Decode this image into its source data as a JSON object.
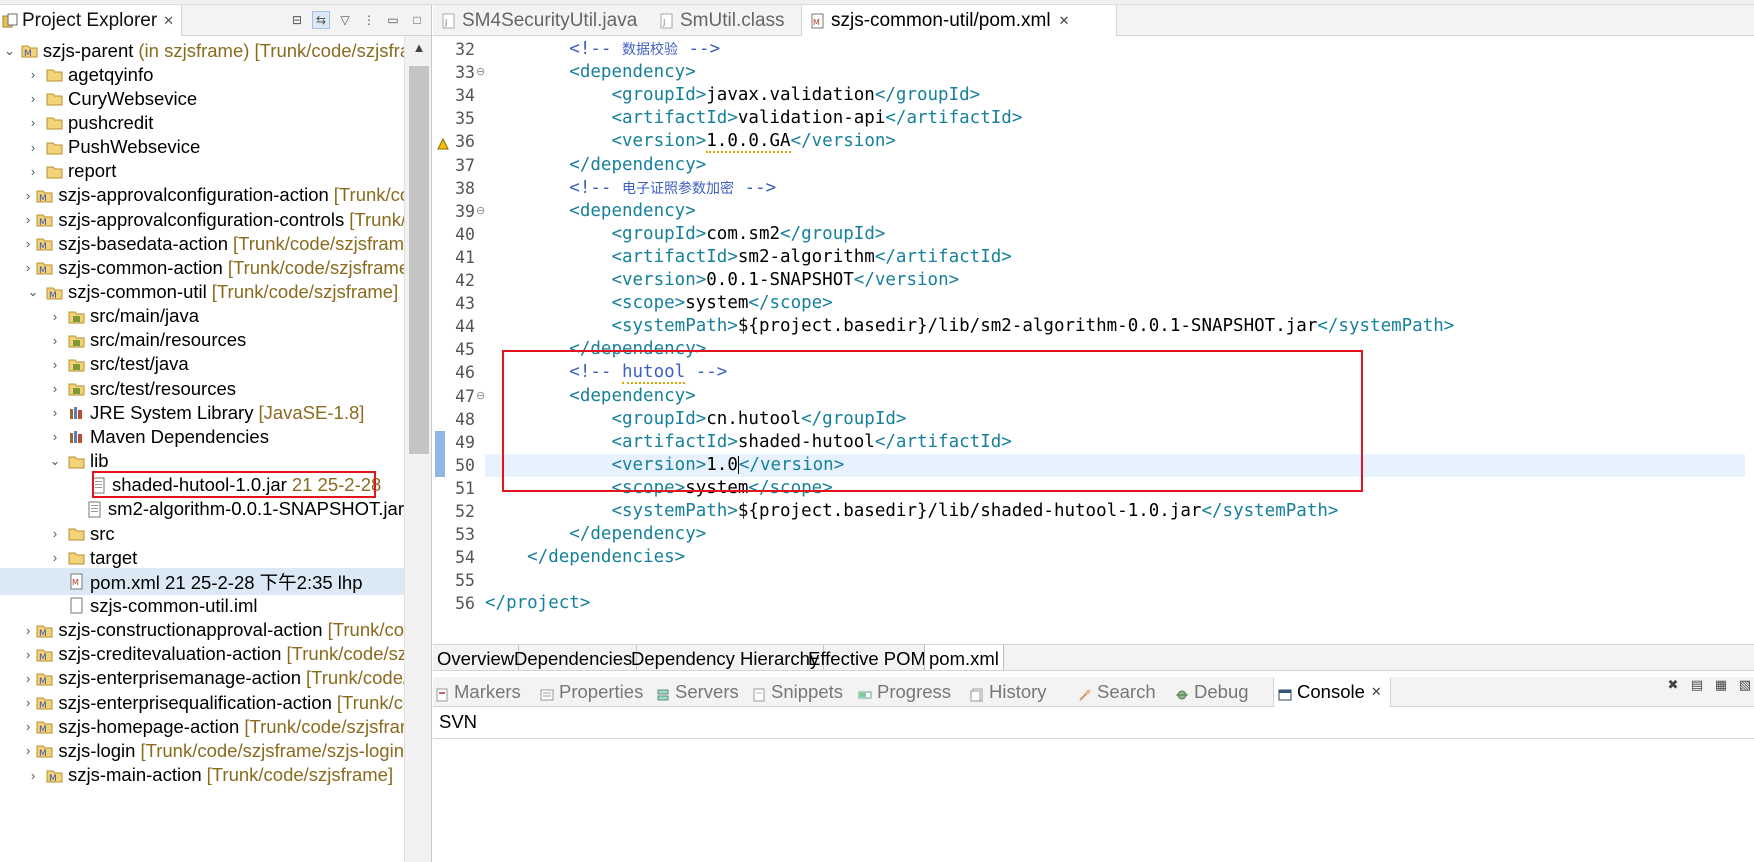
{
  "explorer": {
    "title": "Project Explorer",
    "tree": [
      {
        "label": "szjs-parent",
        "decor": " (in szjsframe) [Trunk/code/szjsframe]",
        "icon": "maven-project-icon",
        "twisty": "open",
        "depth": 0
      },
      {
        "label": "agetqyinfo",
        "decor": "",
        "icon": "folder-icon",
        "twisty": "closed",
        "depth": 1
      },
      {
        "label": "CuryWebsevice",
        "decor": "",
        "icon": "folder-icon",
        "twisty": "closed",
        "depth": 1
      },
      {
        "label": "pushcredit",
        "decor": "",
        "icon": "folder-icon",
        "twisty": "closed",
        "depth": 1
      },
      {
        "label": "PushWebsevice",
        "decor": "",
        "icon": "folder-icon",
        "twisty": "closed",
        "depth": 1
      },
      {
        "label": "report",
        "decor": "",
        "icon": "folder-icon",
        "twisty": "closed",
        "depth": 1
      },
      {
        "label": "szjs-approvalconfiguration-action",
        "decor": " [Trunk/code/szjsframe]",
        "icon": "maven-project-icon",
        "twisty": "closed",
        "depth": 1
      },
      {
        "label": "szjs-approvalconfiguration-controls",
        "decor": " [Trunk/code/szjsframe]",
        "icon": "maven-project-icon",
        "twisty": "closed",
        "depth": 1
      },
      {
        "label": "szjs-basedata-action",
        "decor": " [Trunk/code/szjsframe]",
        "icon": "maven-project-icon",
        "twisty": "closed",
        "depth": 1
      },
      {
        "label": "szjs-common-action",
        "decor": " [Trunk/code/szjsframe]",
        "icon": "maven-project-icon",
        "twisty": "closed",
        "depth": 1
      },
      {
        "label": "szjs-common-util",
        "decor": " [Trunk/code/szjsframe]",
        "icon": "maven-project-icon",
        "twisty": "open",
        "depth": 1
      },
      {
        "label": "src/main/java",
        "decor": "",
        "icon": "source-folder-icon",
        "twisty": "closed",
        "depth": 2
      },
      {
        "label": "src/main/resources",
        "decor": "",
        "icon": "source-folder-icon",
        "twisty": "closed",
        "depth": 2
      },
      {
        "label": "src/test/java",
        "decor": "",
        "icon": "source-folder-icon",
        "twisty": "closed",
        "depth": 2
      },
      {
        "label": "src/test/resources",
        "decor": "",
        "icon": "source-folder-icon",
        "twisty": "closed",
        "depth": 2
      },
      {
        "label": "JRE System Library",
        "decor": " [JavaSE-1.8]",
        "icon": "library-icon",
        "twisty": "closed",
        "depth": 2
      },
      {
        "label": "Maven Dependencies",
        "decor": "",
        "icon": "library-icon",
        "twisty": "closed",
        "depth": 2
      },
      {
        "label": "lib",
        "decor": "",
        "icon": "folder-icon",
        "twisty": "open",
        "depth": 2
      },
      {
        "label": "shaded-hutool-1.0.jar",
        "decor": " 21  25-2-28",
        "icon": "jar-file-icon",
        "twisty": "none",
        "depth": 3
      },
      {
        "label": "sm2-algorithm-0.0.1-SNAPSHOT.jar",
        "decor": "",
        "icon": "jar-file-icon",
        "twisty": "none",
        "depth": 3
      },
      {
        "label": "src",
        "decor": "",
        "icon": "folder-icon",
        "twisty": "closed",
        "depth": 2
      },
      {
        "label": "target",
        "decor": "",
        "icon": "folder-icon",
        "twisty": "closed",
        "depth": 2
      },
      {
        "label": "pom.xml 21  25-2-28 下午2:35  lhp",
        "decor": "",
        "icon": "xml-file-icon",
        "twisty": "none",
        "depth": 2,
        "selected": true
      },
      {
        "label": "szjs-common-util.iml",
        "decor": "",
        "icon": "file-icon",
        "twisty": "none",
        "depth": 2
      },
      {
        "label": "szjs-constructionapproval-action",
        "decor": " [Trunk/code/szjsframe]",
        "icon": "maven-project-icon",
        "twisty": "closed",
        "depth": 1
      },
      {
        "label": "szjs-creditevaluation-action",
        "decor": " [Trunk/code/szjsframe]",
        "icon": "maven-project-icon",
        "twisty": "closed",
        "depth": 1
      },
      {
        "label": "szjs-enterprisemanage-action",
        "decor": " [Trunk/code/szjsframe]",
        "icon": "maven-project-icon",
        "twisty": "closed",
        "depth": 1
      },
      {
        "label": "szjs-enterprisequalification-action",
        "decor": " [Trunk/code/szjsframe]",
        "icon": "maven-project-icon",
        "twisty": "closed",
        "depth": 1
      },
      {
        "label": "szjs-homepage-action",
        "decor": " [Trunk/code/szjsframe]",
        "icon": "maven-project-icon",
        "twisty": "closed",
        "depth": 1
      },
      {
        "label": "szjs-login",
        "decor": " [Trunk/code/szjsframe/szjs-login]",
        "icon": "maven-project-icon",
        "twisty": "closed",
        "depth": 1
      },
      {
        "label": "szjs-main-action",
        "decor": " [Trunk/code/szjsframe]",
        "icon": "maven-project-icon",
        "twisty": "closed",
        "depth": 1
      }
    ]
  },
  "editor": {
    "tabs": [
      {
        "label": "SM4SecurityUtil.java",
        "active": false
      },
      {
        "label": "SmUtil.class",
        "active": false
      },
      {
        "label": "szjs-common-util/pom.xml",
        "active": true
      }
    ],
    "lines": [
      {
        "n": "32",
        "fold": "",
        "indent": 2,
        "comment": "数据校验"
      },
      {
        "n": "33",
        "fold": "⊖",
        "indent": 2,
        "open": "dependency"
      },
      {
        "n": "34",
        "fold": "",
        "indent": 3,
        "tag": "groupId",
        "value": "javax.validation"
      },
      {
        "n": "35",
        "fold": "",
        "indent": 3,
        "tag": "artifactId",
        "value": "validation-api"
      },
      {
        "n": "36",
        "fold": "",
        "indent": 3,
        "tag": "version",
        "value": "1.0.0.GA",
        "warn": true
      },
      {
        "n": "37",
        "fold": "",
        "indent": 2,
        "close": "dependency"
      },
      {
        "n": "38",
        "fold": "",
        "indent": 2,
        "comment": "电子证照参数加密"
      },
      {
        "n": "39",
        "fold": "⊖",
        "indent": 2,
        "open": "dependency"
      },
      {
        "n": "40",
        "fold": "",
        "indent": 3,
        "tag": "groupId",
        "value": "com.sm2"
      },
      {
        "n": "41",
        "fold": "",
        "indent": 3,
        "tag": "artifactId",
        "value": "sm2-algorithm"
      },
      {
        "n": "42",
        "fold": "",
        "indent": 3,
        "tag": "version",
        "value": "0.0.1-SNAPSHOT"
      },
      {
        "n": "43",
        "fold": "",
        "indent": 3,
        "tag": "scope",
        "value": "system"
      },
      {
        "n": "44",
        "fold": "",
        "indent": 3,
        "tag": "systemPath",
        "value": "${project.basedir}/lib/sm2-algorithm-0.0.1-SNAPSHOT.jar"
      },
      {
        "n": "45",
        "fold": "",
        "indent": 2,
        "close": "dependency"
      },
      {
        "n": "46",
        "fold": "",
        "indent": 2,
        "comment": "hutool"
      },
      {
        "n": "47",
        "fold": "⊖",
        "indent": 2,
        "open": "dependency"
      },
      {
        "n": "48",
        "fold": "",
        "indent": 3,
        "tag": "groupId",
        "value": "cn.hutool"
      },
      {
        "n": "49",
        "fold": "",
        "indent": 3,
        "tag": "artifactId",
        "value": "shaded-hutool"
      },
      {
        "n": "50",
        "fold": "",
        "indent": 3,
        "tag": "version",
        "value": "1.0",
        "current": true
      },
      {
        "n": "51",
        "fold": "",
        "indent": 3,
        "tag": "scope",
        "value": "system"
      },
      {
        "n": "52",
        "fold": "",
        "indent": 3,
        "tag": "systemPath",
        "value": "${project.basedir}/lib/shaded-hutool-1.0.jar"
      },
      {
        "n": "53",
        "fold": "",
        "indent": 2,
        "close": "dependency"
      },
      {
        "n": "54",
        "fold": "",
        "indent": 1,
        "close": "dependencies"
      },
      {
        "n": "55",
        "fold": "",
        "indent": 0,
        "blank": true
      },
      {
        "n": "56",
        "fold": "",
        "indent": 0,
        "close": "project"
      }
    ],
    "pom_tabs": [
      "Overview",
      "Dependencies",
      "Dependency Hierarchy",
      "Effective POM",
      "pom.xml"
    ],
    "pom_tab_active": "pom.xml"
  },
  "bottom": {
    "tabs": [
      {
        "label": "Markers",
        "icon": "markers-icon"
      },
      {
        "label": "Properties",
        "icon": "properties-icon"
      },
      {
        "label": "Servers",
        "icon": "servers-icon"
      },
      {
        "label": "Snippets",
        "icon": "snippets-icon"
      },
      {
        "label": "Progress",
        "icon": "progress-icon"
      },
      {
        "label": "History",
        "icon": "history-icon"
      },
      {
        "label": "Search",
        "icon": "search-icon"
      },
      {
        "label": "Debug",
        "icon": "debug-icon"
      },
      {
        "label": "Console",
        "icon": "console-icon",
        "active": true
      }
    ],
    "console_title": "SVN"
  },
  "colors": {
    "xml_tag": "#17809b",
    "xml_comment": "#3f5fbf",
    "highlight_box": "#e2141e",
    "selection": "#dbe9f7",
    "current_line": "#e8f2fe"
  }
}
